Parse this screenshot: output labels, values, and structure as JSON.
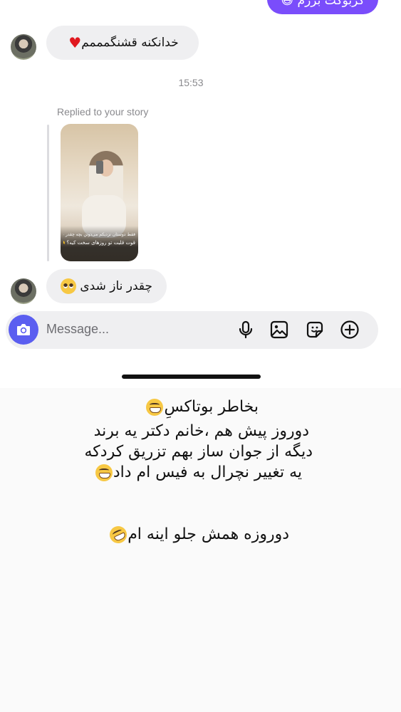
{
  "chat": {
    "sent_partial": "کربوکت بزرم 😅",
    "messages": [
      {
        "text": "خدانکنه قشنگمممم",
        "emoji": "red-heart"
      },
      {
        "text": "چقدر ناز شدی",
        "emoji": "pleading-face"
      }
    ],
    "timestamp": "15:53",
    "replied_label": "Replied to your story",
    "story": {
      "caption_line1": "فقط دوستان نزدیکم می‌دونن بچه چقدر عزیزمه♥",
      "caption_line2": "قوت قلبت تو روزهای سخت کیه؟ 🫶🫶"
    }
  },
  "composer": {
    "placeholder": "Message...",
    "icons": [
      "camera-icon",
      "microphone-icon",
      "image-icon",
      "sticker-icon",
      "add-icon"
    ]
  },
  "note": {
    "lines": [
      "بخاطر بوتاکسِ",
      "دوروز پیش هم  ،خانم دکتر یه برند",
      "دیگه از جوان ساز بهم تزریق کردکه",
      "یه تغییر نچرال به فیس ام داد",
      "دوروزه همش جلو اینه ام"
    ],
    "emojis": [
      "grinning-face",
      "grinning-face",
      "rolling-on-floor-laughing"
    ]
  },
  "colors": {
    "accent": "#7a4dfb",
    "camera": "#5b5ef0",
    "bubble": "#efeff1",
    "heart": "#e0181f"
  }
}
